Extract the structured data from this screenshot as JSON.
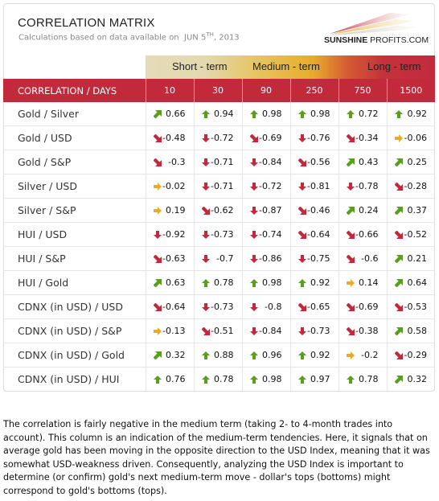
{
  "header": {
    "title": "CORRELATION MATRIX",
    "subtitle_prefix": "Calculations based on data available on",
    "date_month_day": "JUN 5",
    "date_suffix": "TH",
    "date_year": ", 2013",
    "logo_bold": "SUNSHINE",
    "logo_rest": " PROFITS.COM"
  },
  "terms": {
    "short": "Short - term",
    "medium": "Medium - term",
    "long": "Long - term"
  },
  "colors": {
    "header_red": "#c22a3c",
    "up": "#5a9e1e",
    "down": "#c22a3c",
    "flat": "#e8ab2a"
  },
  "table": {
    "corner_label": "CORRELATION / DAYS",
    "days": [
      "10",
      "30",
      "90",
      "250",
      "750",
      "1500"
    ],
    "rows": [
      {
        "label": "Gold / Silver",
        "cells": [
          {
            "v": "0.66",
            "a": "up-right"
          },
          {
            "v": "0.94",
            "a": "up"
          },
          {
            "v": "0.98",
            "a": "up"
          },
          {
            "v": "0.98",
            "a": "up"
          },
          {
            "v": "0.72",
            "a": "up"
          },
          {
            "v": "0.92",
            "a": "up"
          }
        ]
      },
      {
        "label": "Gold / USD",
        "cells": [
          {
            "v": "-0.48",
            "a": "down-right"
          },
          {
            "v": "-0.72",
            "a": "down"
          },
          {
            "v": "-0.69",
            "a": "down-right"
          },
          {
            "v": "-0.76",
            "a": "down"
          },
          {
            "v": "-0.34",
            "a": "down-right"
          },
          {
            "v": "-0.06",
            "a": "right"
          }
        ]
      },
      {
        "label": "Gold / S&P",
        "cells": [
          {
            "v": "-0.3",
            "a": "down-right"
          },
          {
            "v": "-0.71",
            "a": "down"
          },
          {
            "v": "-0.84",
            "a": "down"
          },
          {
            "v": "-0.56",
            "a": "down-right"
          },
          {
            "v": "0.43",
            "a": "up-right"
          },
          {
            "v": "0.25",
            "a": "up-right"
          }
        ]
      },
      {
        "label": "Silver / USD",
        "cells": [
          {
            "v": "-0.02",
            "a": "right"
          },
          {
            "v": "-0.71",
            "a": "down"
          },
          {
            "v": "-0.72",
            "a": "down"
          },
          {
            "v": "-0.81",
            "a": "down"
          },
          {
            "v": "-0.78",
            "a": "down"
          },
          {
            "v": "-0.28",
            "a": "down-right"
          }
        ]
      },
      {
        "label": "Silver / S&P",
        "cells": [
          {
            "v": "0.19",
            "a": "right"
          },
          {
            "v": "-0.62",
            "a": "down-right"
          },
          {
            "v": "-0.87",
            "a": "down"
          },
          {
            "v": "-0.46",
            "a": "down-right"
          },
          {
            "v": "0.24",
            "a": "up-right"
          },
          {
            "v": "0.37",
            "a": "up-right"
          }
        ]
      },
      {
        "label": "HUI / USD",
        "cells": [
          {
            "v": "-0.92",
            "a": "down"
          },
          {
            "v": "-0.73",
            "a": "down"
          },
          {
            "v": "-0.74",
            "a": "down"
          },
          {
            "v": "-0.64",
            "a": "down-right"
          },
          {
            "v": "-0.66",
            "a": "down-right"
          },
          {
            "v": "-0.52",
            "a": "down-right"
          }
        ]
      },
      {
        "label": "HUI / S&P",
        "cells": [
          {
            "v": "-0.63",
            "a": "down-right"
          },
          {
            "v": "-0.7",
            "a": "down"
          },
          {
            "v": "-0.86",
            "a": "down"
          },
          {
            "v": "-0.75",
            "a": "down"
          },
          {
            "v": "-0.6",
            "a": "down-right"
          },
          {
            "v": "0.21",
            "a": "up-right"
          }
        ]
      },
      {
        "label": "HUI / Gold",
        "cells": [
          {
            "v": "0.63",
            "a": "up-right"
          },
          {
            "v": "0.78",
            "a": "up"
          },
          {
            "v": "0.98",
            "a": "up"
          },
          {
            "v": "0.92",
            "a": "up"
          },
          {
            "v": "0.14",
            "a": "right"
          },
          {
            "v": "0.64",
            "a": "up-right"
          }
        ]
      },
      {
        "label": "CDNX (in USD) / USD",
        "cells": [
          {
            "v": "-0.64",
            "a": "down-right"
          },
          {
            "v": "-0.73",
            "a": "down"
          },
          {
            "v": "-0.8",
            "a": "down"
          },
          {
            "v": "-0.65",
            "a": "down-right"
          },
          {
            "v": "-0.69",
            "a": "down-right"
          },
          {
            "v": "-0.53",
            "a": "down-right"
          }
        ]
      },
      {
        "label": "CDNX (in USD) / S&P",
        "cells": [
          {
            "v": "-0.13",
            "a": "right"
          },
          {
            "v": "-0.51",
            "a": "down-right"
          },
          {
            "v": "-0.84",
            "a": "down"
          },
          {
            "v": "-0.73",
            "a": "down"
          },
          {
            "v": "-0.38",
            "a": "down-right"
          },
          {
            "v": "0.58",
            "a": "up-right"
          }
        ]
      },
      {
        "label": "CDNX (in USD) / Gold",
        "cells": [
          {
            "v": "0.32",
            "a": "up-right"
          },
          {
            "v": "0.88",
            "a": "up"
          },
          {
            "v": "0.96",
            "a": "up"
          },
          {
            "v": "0.92",
            "a": "up"
          },
          {
            "v": "-0.2",
            "a": "right"
          },
          {
            "v": "-0.29",
            "a": "down-right"
          }
        ]
      },
      {
        "label": "CDNX (in USD) / HUI",
        "cells": [
          {
            "v": "0.76",
            "a": "up"
          },
          {
            "v": "0.78",
            "a": "up"
          },
          {
            "v": "0.98",
            "a": "up"
          },
          {
            "v": "0.97",
            "a": "up"
          },
          {
            "v": "0.78",
            "a": "up"
          },
          {
            "v": "0.32",
            "a": "up-right"
          }
        ]
      }
    ]
  },
  "note": "The correlation is fairly negative in the medium term (taking 2- to 4-month trades into account). This column is an indication of the medium-term tendencies. Here, it signals that on average gold has been moving in the opposite direction to the USD Index, meaning that it was somewhat USD-weakness driven. Consequently, analyzing the USD Index is important to determine (or confirm) gold's next medium-term move - dollar's tops (bottoms) might correspond to gold's bottoms (tops)."
}
